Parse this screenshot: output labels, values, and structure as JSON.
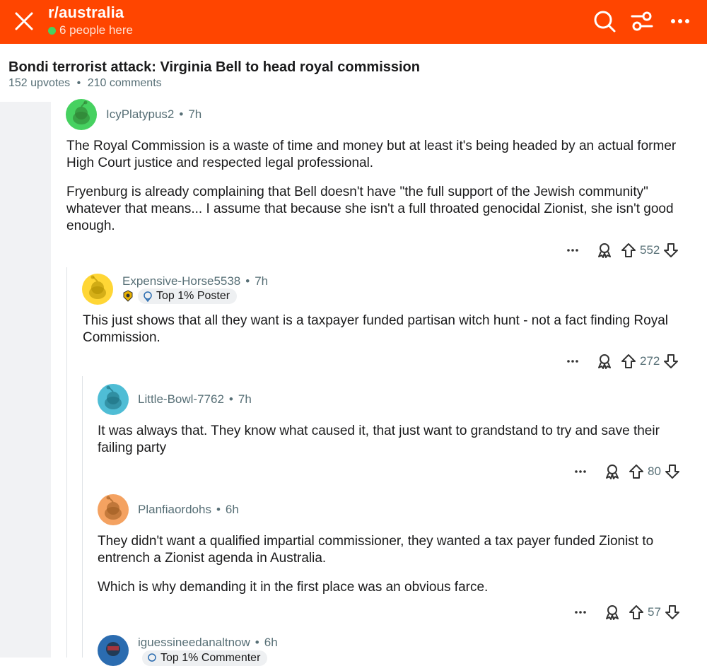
{
  "topbar": {
    "subreddit": "r/australia",
    "presence": "6 people here",
    "icons": [
      "close-icon",
      "search-icon",
      "filter-icon",
      "more-icon"
    ],
    "brand_color": "#ff4500"
  },
  "post": {
    "title": "Bondi terrorist attack: Virginia Bell to head royal commission",
    "upvotes": "152 upvotes",
    "comments": "210 comments"
  },
  "comments": [
    {
      "author": "IcyPlatypus2",
      "age": "7h",
      "paragraphs": [
        "The Royal Commission is a waste of time and money but at least it's being headed by an actual former High Court justice and respected legal professional.",
        "Fryenburg is already complaining that Bell doesn't have \"the full support of the Jewish community\" whatever that means... I assume that because she isn't a full throated genocidal Zionist, she isn't good enough."
      ],
      "votes": "552",
      "avatar_color": "#46d160"
    },
    {
      "author": "Expensive-Horse5538",
      "age": "7h",
      "flair": "Top 1% Poster",
      "paragraphs": [
        "This just shows that all they want is a taxpayer funded partisan witch hunt - not a fact finding Royal Commission."
      ],
      "votes": "272",
      "avatar_color": "#ffd635"
    },
    {
      "author": "Little-Bowl-7762",
      "age": "7h",
      "paragraphs": [
        "It was always that. They know what caused it, that just want to grandstand to try and save their failing party"
      ],
      "votes": "80",
      "avatar_color": "#4fbdd5"
    },
    {
      "author": "Planfiaordohs",
      "age": "6h",
      "paragraphs": [
        "They didn't want a qualified impartial commissioner, they wanted a tax payer funded Zionist to entrench a Zionist agenda in Australia.",
        "Which is why demanding it in the first place was an obvious farce."
      ],
      "votes": "57",
      "avatar_color": "#f4a261"
    },
    {
      "author": "iguessineedanaltnow",
      "age": "6h",
      "flair": "Top 1% Commenter",
      "avatar_color": "#2b6cb0"
    }
  ]
}
